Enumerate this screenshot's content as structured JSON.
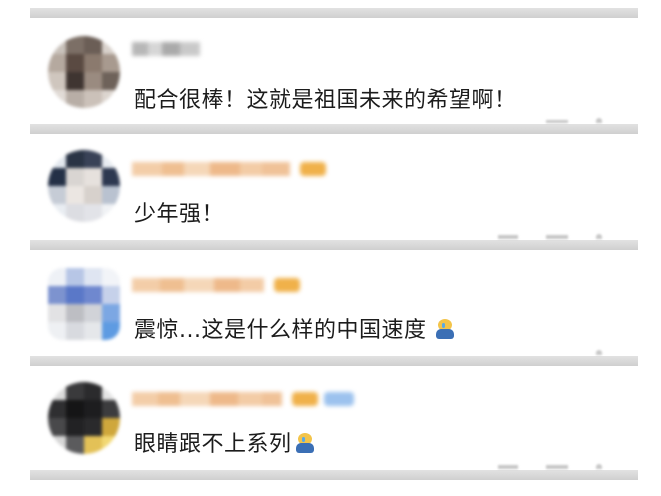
{
  "comments": [
    {
      "text": "配合很棒！这就是祖国未来的希望啊！",
      "has_emoji": false,
      "avatar_icon": "user-avatar-icon",
      "emoji_icon": ""
    },
    {
      "text": "少年强！",
      "has_emoji": false,
      "avatar_icon": "user-avatar-icon",
      "emoji_icon": ""
    },
    {
      "text": "震惊...这是什么样的中国速度",
      "has_emoji": true,
      "avatar_icon": "user-avatar-icon",
      "emoji_icon": "crying-emoji-icon"
    },
    {
      "text": "眼睛跟不上系列",
      "has_emoji": true,
      "avatar_icon": "user-avatar-icon",
      "emoji_icon": "crying-emoji-icon"
    }
  ],
  "colors": {
    "separator": "#d4d4d4",
    "comment_text": "#1c1c1c",
    "nickname_blur": "#f2c79a",
    "badge_orange": "#f0b14a",
    "badge_blue": "#9cc2ee"
  }
}
